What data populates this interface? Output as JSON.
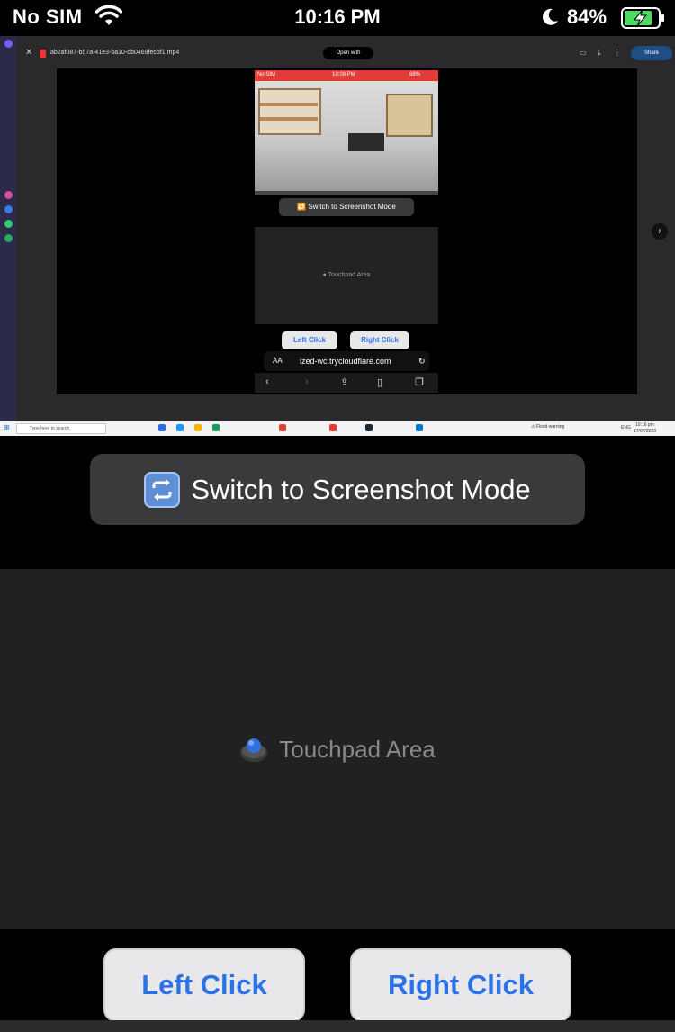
{
  "status_bar": {
    "carrier": "No SIM",
    "time": "10:16 PM",
    "battery_percent": "84%",
    "battery_level": 0.84,
    "battery_color": "#4cd964"
  },
  "remote": {
    "file_name": "ab2af087-b57a-41e3-ba10-db0469fecbf1.mp4",
    "open_with": "Open with",
    "share": "Share",
    "phone": {
      "carrier": "No SIM",
      "time": "10:08 PM",
      "battery": "88%",
      "switch_label": "Switch to Screenshot Mode",
      "touchpad_label": "Touchpad Area",
      "left_click": "Left Click",
      "right_click": "Right Click",
      "url_prefix": "AA",
      "url": "ized-wc.trycloudflare.com"
    },
    "taskbar": {
      "search_placeholder": "Type here to search",
      "weather_warning": "Flood warning",
      "language": "ENG",
      "time": "10:16 pm",
      "date": "17/07/2023"
    }
  },
  "controls": {
    "switch_label": "Switch to Screenshot Mode",
    "touchpad_label": "Touchpad Area",
    "left_click": "Left Click",
    "right_click": "Right Click"
  },
  "colors": {
    "accent": "#2b72e6",
    "button_bg": "#e8e8ea",
    "dark_button_bg": "#3a3a3c",
    "touchpad_bg": "#212121"
  }
}
